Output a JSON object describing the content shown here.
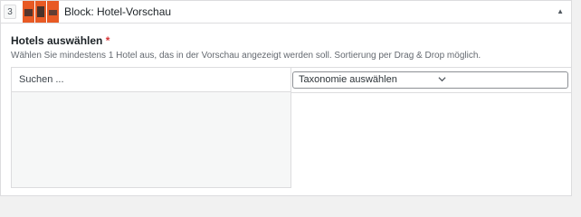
{
  "block": {
    "number": "3",
    "title": "Block: Hotel-Vorschau",
    "toggle_icon": "triangle-up-icon"
  },
  "field": {
    "label": "Hotels auswählen",
    "required_mark": "*",
    "description": "Wählen Sie mindestens 1 Hotel aus, das in der Vorschau angezeigt werden soll. Sortierung per Drag & Drop möglich."
  },
  "selector": {
    "search_placeholder": "Suchen ...",
    "taxonomy_selected": "Taxonomie auswählen"
  },
  "colors": {
    "thumb_accent": "#e85a24",
    "required": "#d63638"
  }
}
